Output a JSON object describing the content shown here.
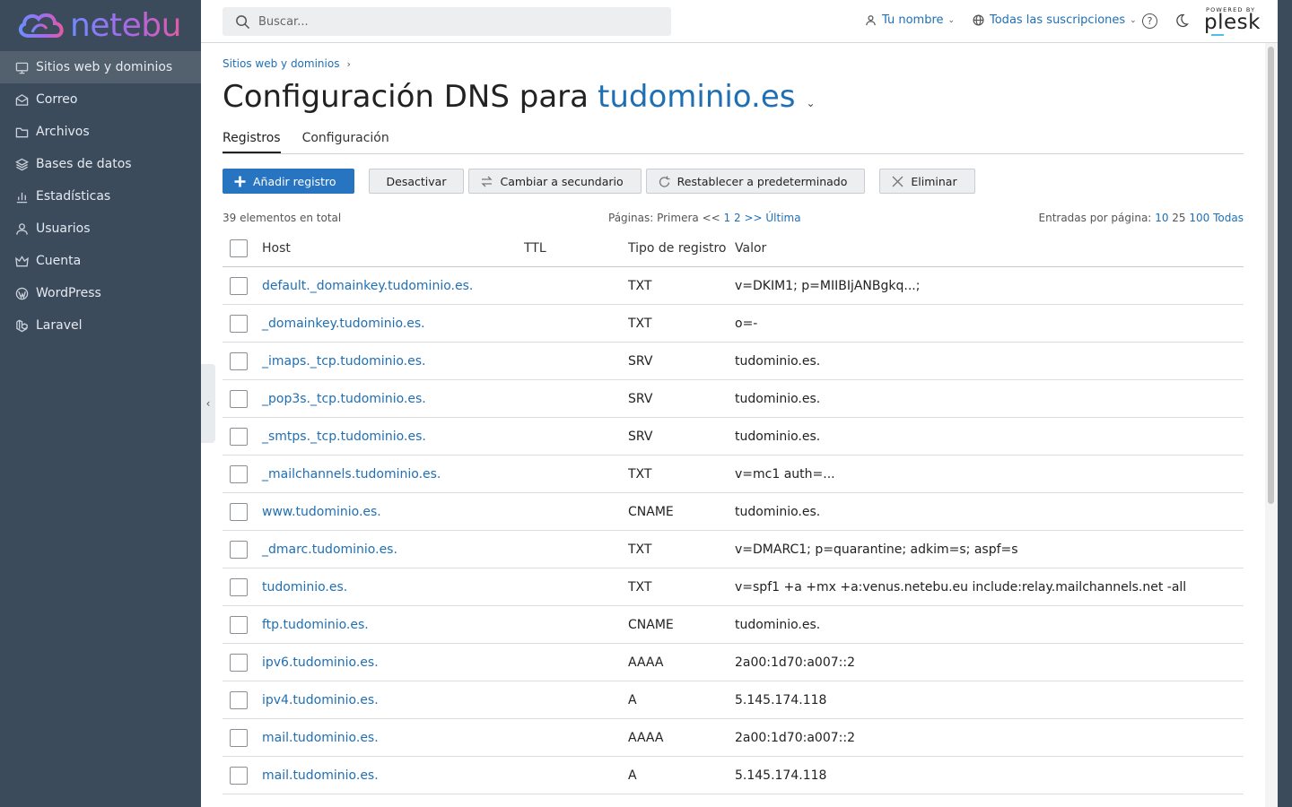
{
  "brand": {
    "logo_text": "netebu"
  },
  "sidebar": {
    "items": [
      {
        "label": "Sitios web y dominios",
        "icon": "monitor-icon",
        "active": true
      },
      {
        "label": "Correo",
        "icon": "mail-icon"
      },
      {
        "label": "Archivos",
        "icon": "folder-icon"
      },
      {
        "label": "Bases de datos",
        "icon": "database-icon"
      },
      {
        "label": "Estadísticas",
        "icon": "stats-icon"
      },
      {
        "label": "Usuarios",
        "icon": "user-icon"
      },
      {
        "label": "Cuenta",
        "icon": "crown-icon"
      },
      {
        "label": "WordPress",
        "icon": "wordpress-icon"
      },
      {
        "label": "Laravel",
        "icon": "laravel-icon"
      }
    ]
  },
  "header": {
    "search_placeholder": "Buscar...",
    "user_label": "Tu nombre",
    "subscriptions_label": "Todas las suscripciones",
    "help_symbol": "?",
    "powered_by": "POWERED BY",
    "plesk": "plesk"
  },
  "breadcrumb": {
    "item": "Sitios web y dominios"
  },
  "page": {
    "title_prefix": "Configuración DNS para",
    "domain": "tudominio.es"
  },
  "tabs": [
    {
      "label": "Registros",
      "active": true
    },
    {
      "label": "Configuración"
    }
  ],
  "toolbar": {
    "add": "Añadir registro",
    "disable": "Desactivar",
    "secondary": "Cambiar a secundario",
    "reset": "Restablecer a predeterminado",
    "delete": "Eliminar"
  },
  "stats": {
    "total": "39 elementos en total",
    "pages_label": "Páginas:",
    "first": "Primera",
    "prev": "<<",
    "page1": "1",
    "page2": "2",
    "next": ">>",
    "last": "Última",
    "perpage_label": "Entradas por página:",
    "pp10": "10",
    "pp25": "25",
    "pp100": "100",
    "pp_all": "Todas"
  },
  "table": {
    "columns": {
      "host": "Host",
      "ttl": "TTL",
      "type": "Tipo de registro",
      "value": "Valor"
    },
    "rows": [
      {
        "host": "default._domainkey.tudominio.es.",
        "ttl": "",
        "type": "TXT",
        "value": "v=DKIM1; p=MIIBIjANBgkq...;"
      },
      {
        "host": "_domainkey.tudominio.es.",
        "ttl": "",
        "type": "TXT",
        "value": "o=-"
      },
      {
        "host": "_imaps._tcp.tudominio.es.",
        "ttl": "",
        "type": "SRV",
        "value": "tudominio.es."
      },
      {
        "host": "_pop3s._tcp.tudominio.es.",
        "ttl": "",
        "type": "SRV",
        "value": "tudominio.es."
      },
      {
        "host": "_smtps._tcp.tudominio.es.",
        "ttl": "",
        "type": "SRV",
        "value": "tudominio.es."
      },
      {
        "host": "_mailchannels.tudominio.es.",
        "ttl": "",
        "type": "TXT",
        "value": "v=mc1 auth=..."
      },
      {
        "host": "www.tudominio.es.",
        "ttl": "",
        "type": "CNAME",
        "value": "tudominio.es."
      },
      {
        "host": "_dmarc.tudominio.es.",
        "ttl": "",
        "type": "TXT",
        "value": "v=DMARC1; p=quarantine; adkim=s; aspf=s"
      },
      {
        "host": "tudominio.es.",
        "ttl": "",
        "type": "TXT",
        "value": "v=spf1 +a +mx +a:venus.netebu.eu include:relay.mailchannels.net -all"
      },
      {
        "host": "ftp.tudominio.es.",
        "ttl": "",
        "type": "CNAME",
        "value": "tudominio.es."
      },
      {
        "host": "ipv6.tudominio.es.",
        "ttl": "",
        "type": "AAAA",
        "value": "2a00:1d70:a007::2"
      },
      {
        "host": "ipv4.tudominio.es.",
        "ttl": "",
        "type": "A",
        "value": "5.145.174.118"
      },
      {
        "host": "mail.tudominio.es.",
        "ttl": "",
        "type": "AAAA",
        "value": "2a00:1d70:a007::2"
      },
      {
        "host": "mail.tudominio.es.",
        "ttl": "",
        "type": "A",
        "value": "5.145.174.118"
      }
    ]
  },
  "colors": {
    "accent": "#2774c0",
    "link": "#1f6fb4",
    "sidebar": "#3c4b5c",
    "sidebar_active": "#53606e"
  }
}
